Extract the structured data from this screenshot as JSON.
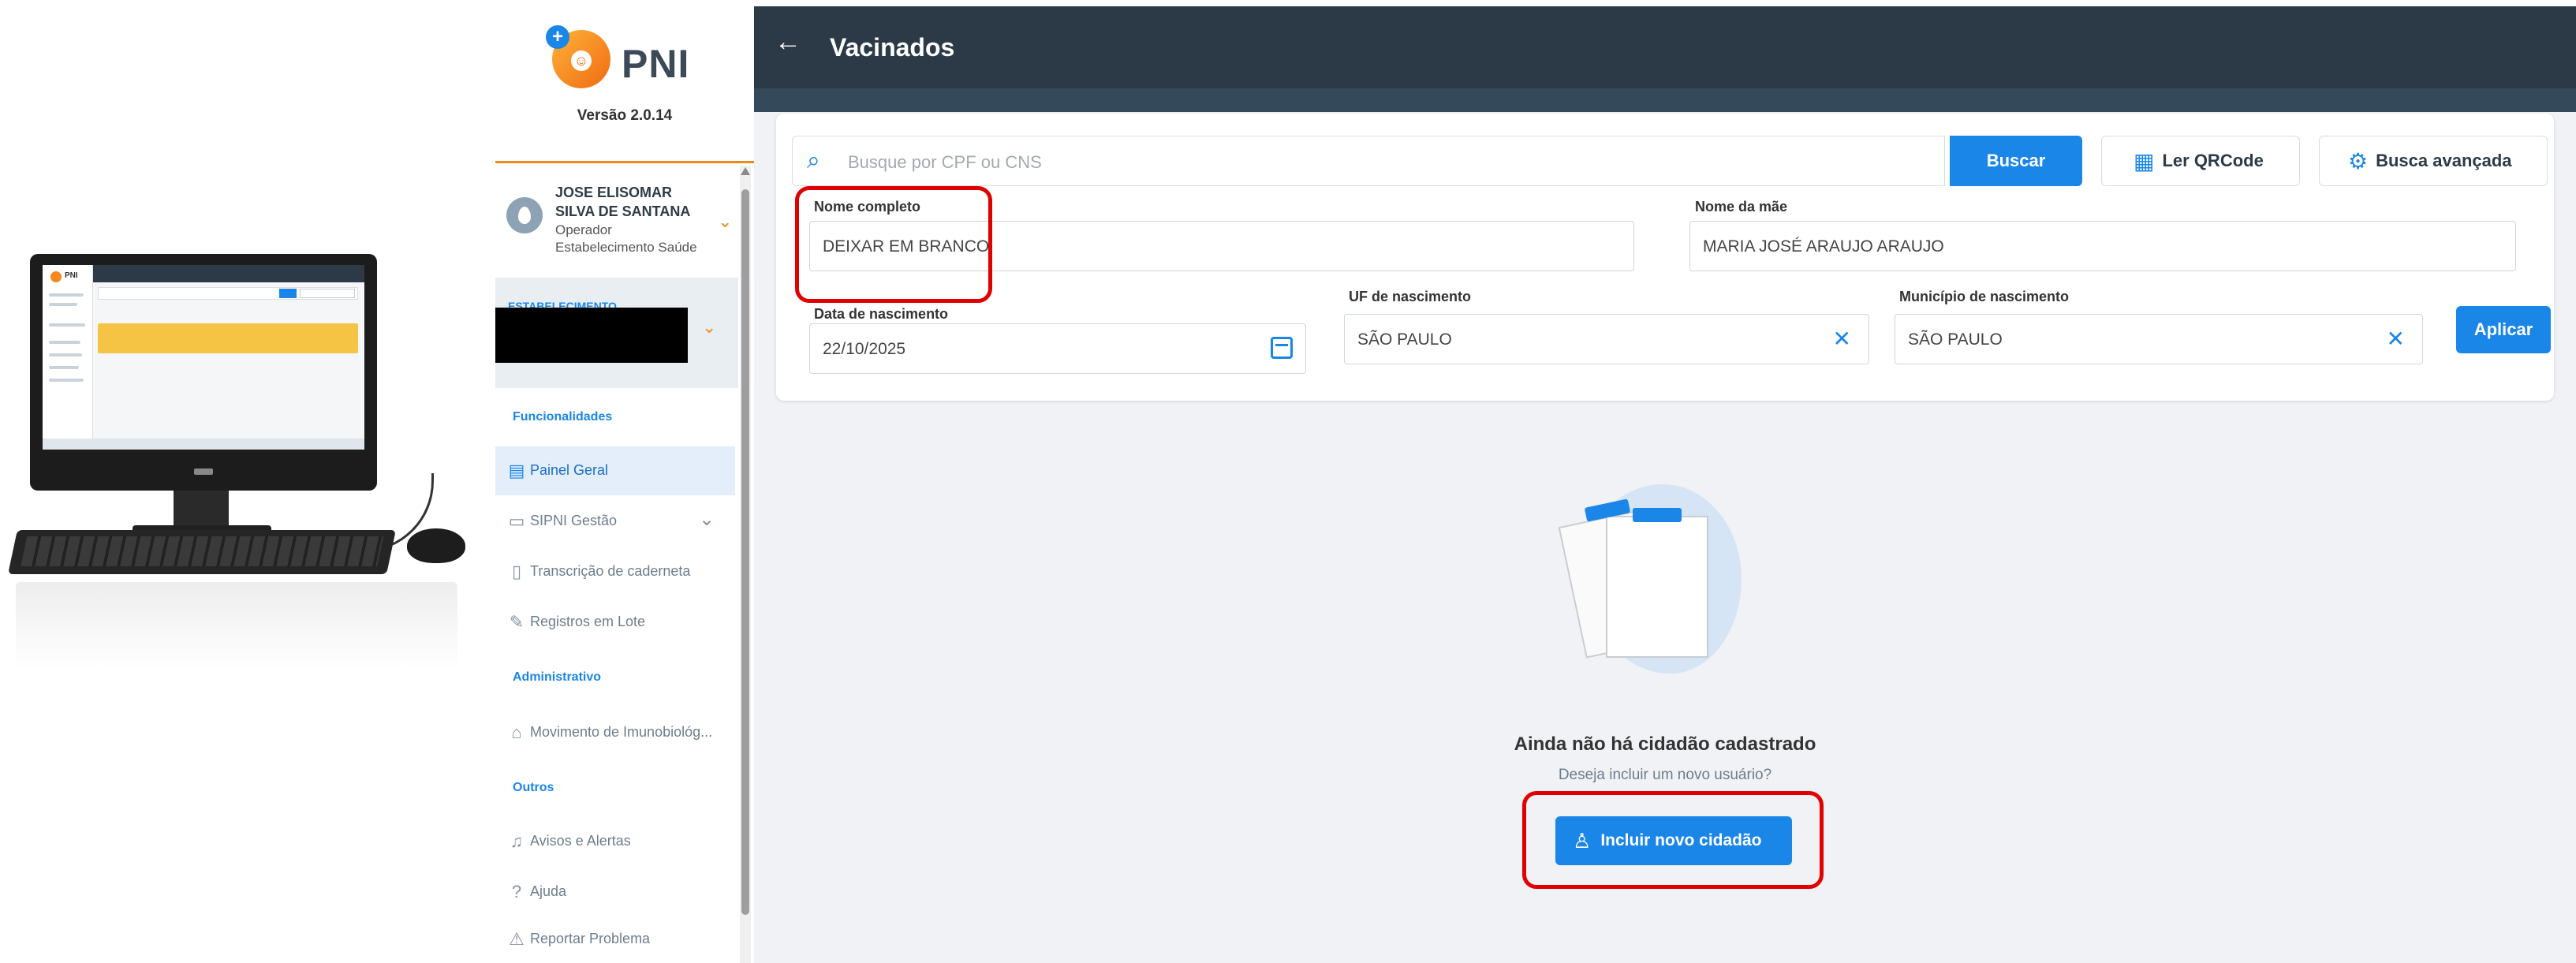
{
  "sidebar": {
    "brand": "PNI",
    "version": "Versão 2.0.14",
    "user": {
      "name": "JOSE ELISOMAR SILVA DE SANTANA",
      "role": "Operador",
      "establishment_type": "Estabelecimento Saúde"
    },
    "establishment_label": "ESTABELECIMENTO",
    "sections": {
      "funcionalidades": "Funcionalidades",
      "administrativo": "Administrativo",
      "outros": "Outros"
    },
    "items": [
      {
        "label": "Painel Geral",
        "icon": "dashboard-icon",
        "active": true
      },
      {
        "label": "SIPNI Gestão",
        "icon": "laptop-icon"
      },
      {
        "label": "Transcrição de caderneta",
        "icon": "notebook-icon"
      },
      {
        "label": "Registros em Lote",
        "icon": "syringe-icon"
      },
      {
        "label": "Movimento de Imunobiológ...",
        "icon": "hand-box-icon"
      },
      {
        "label": "Avisos e Alertas",
        "icon": "bell-icon"
      },
      {
        "label": "Ajuda",
        "icon": "help-circle-icon"
      },
      {
        "label": "Reportar Problema",
        "icon": "report-icon"
      }
    ]
  },
  "header": {
    "title": "Vacinados"
  },
  "search": {
    "placeholder": "Busque por CPF ou CNS",
    "buscar_label": "Buscar",
    "qrcode_label": "Ler QRCode",
    "advanced_label": "Busca avançada"
  },
  "filters": {
    "nome_completo": {
      "label": "Nome completo",
      "value": "DEIXAR EM BRANCO"
    },
    "nome_mae": {
      "label": "Nome da mãe",
      "value": "MARIA JOSÉ ARAUJO ARAUJO"
    },
    "data_nascimento": {
      "label": "Data de nascimento",
      "value": "22/10/2025"
    },
    "uf_nascimento": {
      "label": "UF de nascimento",
      "value": "SÃO PAULO"
    },
    "municipio_nascimento": {
      "label": "Município de nascimento",
      "value": "SÃO PAULO"
    },
    "aplicar_label": "Aplicar"
  },
  "empty_state": {
    "title": "Ainda não há cidadão cadastrado",
    "subtitle": "Deseja incluir um novo usuário?",
    "button_label": "Incluir novo cidadão"
  },
  "colors": {
    "primary": "#1a86e8",
    "topbar": "#2c3a47",
    "accent": "#f5871f",
    "highlight": "#e00000"
  }
}
